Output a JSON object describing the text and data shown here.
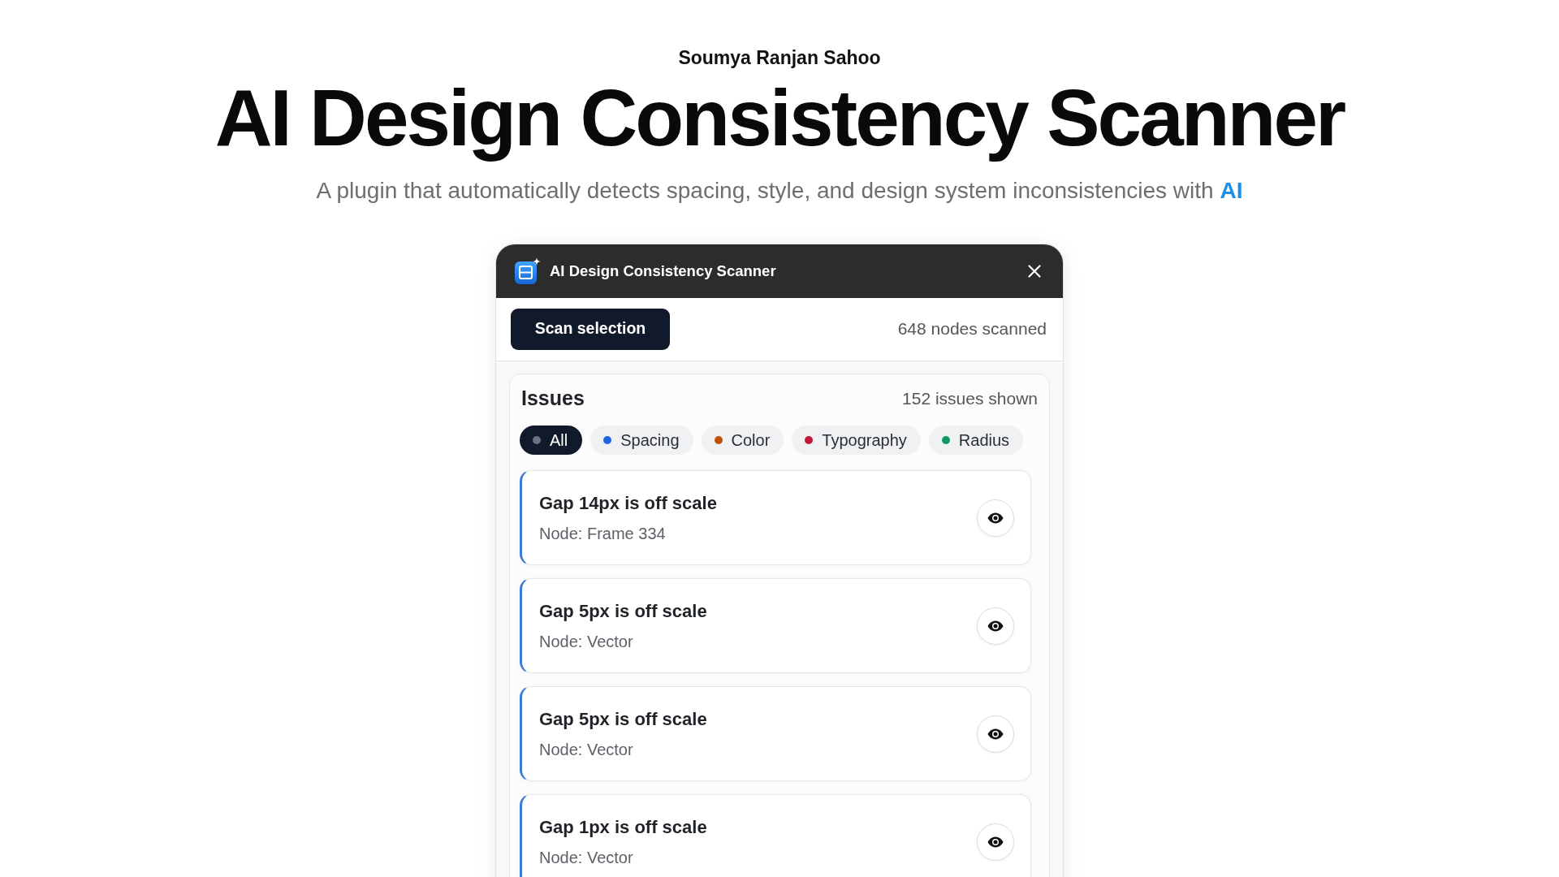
{
  "header": {
    "author": "Soumya Ranjan Sahoo",
    "title": "AI Design Consistency Scanner",
    "subtitle": "A plugin that automatically detects spacing, style, and design system inconsistencies with **AI**"
  },
  "plugin": {
    "title": "AI Design Consistency Scanner",
    "scan_button": "Scan selection",
    "scan_status": "648 nodes scanned",
    "issues": {
      "title": "Issues",
      "count": "152 issues shown",
      "filters": [
        {
          "label": "All",
          "selected": true,
          "color": "#6b7280"
        },
        {
          "label": "Spacing",
          "selected": false,
          "color": "#1d64e0"
        },
        {
          "label": "Color",
          "selected": false,
          "color": "#c2500a"
        },
        {
          "label": "Typography",
          "selected": false,
          "color": "#c0193a"
        },
        {
          "label": "Radius",
          "selected": false,
          "color": "#0f9960"
        }
      ],
      "items": [
        {
          "title": "Gap 14px is off scale",
          "node": "Node: Frame 334"
        },
        {
          "title": "Gap 5px is off scale",
          "node": "Node: Vector"
        },
        {
          "title": "Gap 5px is off scale",
          "node": "Node: Vector"
        },
        {
          "title": "Gap 1px is off scale",
          "node": "Node: Vector"
        }
      ]
    }
  }
}
